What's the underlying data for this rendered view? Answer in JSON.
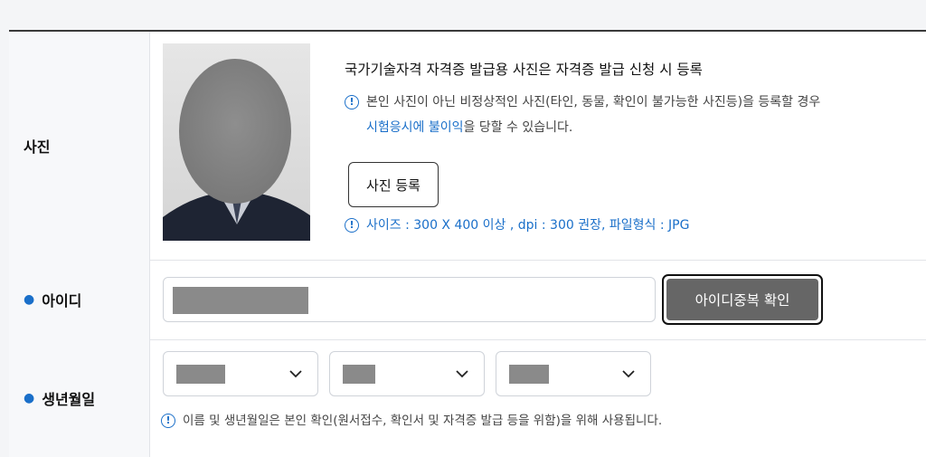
{
  "photo": {
    "label": "사진",
    "title": "국가기술자격 자격증 발급용 사진은 자격증 발급 신청 시 등록",
    "notice_icon": "exclamation-circle-icon",
    "notice_line1": "본인 사진이 아닌 비정상적인 사진(타인, 동물, 확인이 불가능한 사진등)을 등록할 경우",
    "notice_line2_highlight": "시험응시에 불이익",
    "notice_line2_rest": "을 당할 수 있습니다.",
    "register_button": "사진 등록",
    "size_info": "사이즈 : 300 X 400 이상 , dpi : 300 권장, 파일형식 : JPG"
  },
  "user_id": {
    "label": "아이디",
    "input_value": "",
    "check_button": "아이디중복 확인"
  },
  "birthdate": {
    "label": "생년월일",
    "year_value": "",
    "month_value": "",
    "day_value": "",
    "notice": "이름 및 생년월일은 본인 확인(원서접수, 확인서 및 자격증 발급 등을 위함)을 위해 사용됩니다."
  },
  "colors": {
    "accent": "#1a6fc9",
    "dark_button": "#666666",
    "label_bg": "#f7f8fa"
  }
}
